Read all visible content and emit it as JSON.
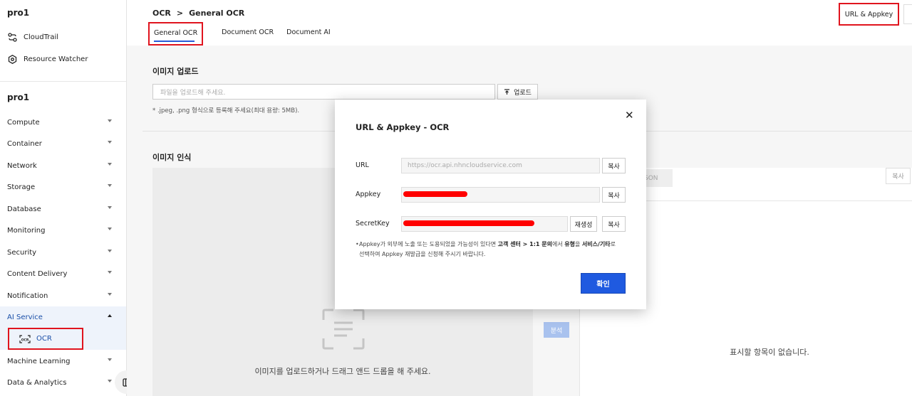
{
  "sidebar": {
    "project_top": "pro1",
    "utilities": [
      {
        "label": "CloudTrail",
        "icon": "cloudtrail-icon"
      },
      {
        "label": "Resource Watcher",
        "icon": "resource-watcher-icon"
      }
    ],
    "project": "pro1",
    "items": [
      {
        "label": "Compute"
      },
      {
        "label": "Container"
      },
      {
        "label": "Network"
      },
      {
        "label": "Storage"
      },
      {
        "label": "Database"
      },
      {
        "label": "Monitoring"
      },
      {
        "label": "Security"
      },
      {
        "label": "Content Delivery"
      },
      {
        "label": "Notification"
      },
      {
        "label": "AI Service",
        "active": true
      },
      {
        "label": "Machine Learning"
      },
      {
        "label": "Data & Analytics"
      }
    ],
    "sub_item": {
      "label": "OCR",
      "icon": "ocr-icon"
    }
  },
  "header": {
    "breadcrumb": [
      "OCR",
      ">",
      "General OCR"
    ],
    "tabs": [
      {
        "label": "General OCR",
        "active": true
      },
      {
        "label": "Document OCR"
      },
      {
        "label": "Document AI"
      }
    ],
    "url_appkey_button": "URL & Appkey"
  },
  "upload": {
    "title": "이미지 업로드",
    "placeholder": "파일을 업로드해 주세요.",
    "button": "업로드",
    "hint": "* .jpeg, .png 형식으로 등록해 주세요(최대 용량: 5MB)."
  },
  "recognition": {
    "title": "이미지 인식",
    "drop_text": "이미지를 업로드하거나 드래그 앤드 드롭을 해 주세요.",
    "analyze_button": "분석",
    "json_tab": "SON",
    "copy_button": "복사",
    "empty_text": "표시할 항목이 없습니다."
  },
  "modal": {
    "title": "URL & Appkey - OCR",
    "url_label": "URL",
    "url_value": "https://ocr.api.nhncloudservice.com",
    "appkey_label": "Appkey",
    "secretkey_label": "SecretKey",
    "copy_label": "복사",
    "regenerate_label": "재생성",
    "note_prefix": "Appkey가 외부에 노출 또는 도용되었을 가능성이 있다면 ",
    "note_bold1": "고객 센터 > 1:1 문의",
    "note_mid": "에서 ",
    "note_bold2": "유형",
    "note_mid2": "을 ",
    "note_bold3": "서비스/기타",
    "note_suffix": "로",
    "note_line2": "선택하여 Appkey 재발급을 신청해 주시기 바랍니다.",
    "confirm_button": "확인",
    "redaction_color": "#ff0000"
  },
  "colors": {
    "accent": "#1f5ae0",
    "highlight_box": "#e0141e",
    "active_nav_bg": "#eef3fb"
  }
}
